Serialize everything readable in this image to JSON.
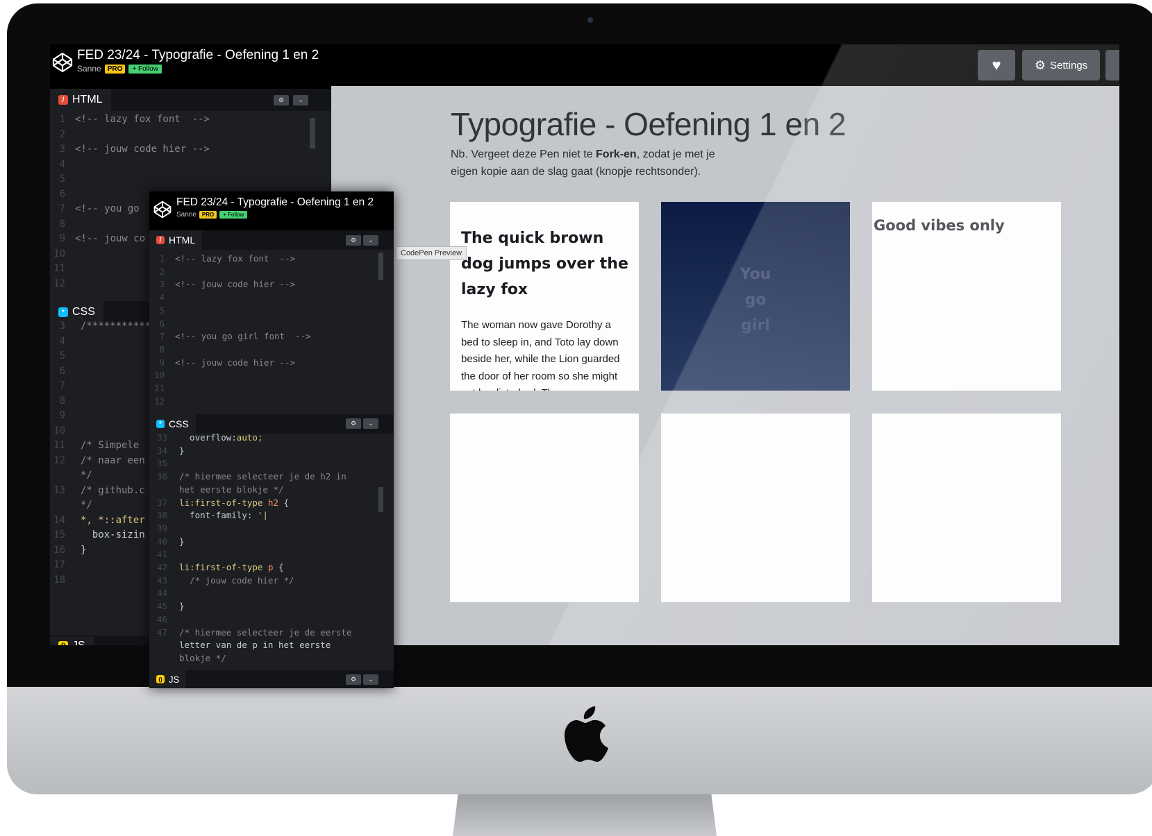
{
  "pen": {
    "title": "FED 23/24 - Typografie - Oefening 1 en 2",
    "author": "Sanne",
    "pro_badge": "PRO",
    "follow_label": "+ Follow"
  },
  "toolbar": {
    "heart_icon": "heart-icon",
    "settings_label": "Settings",
    "settings_icon": "gear-icon"
  },
  "panes": {
    "html_label": "HTML",
    "css_label": "CSS",
    "js_label": "JS"
  },
  "back_editor": {
    "html_lines": [
      {
        "n": "1",
        "text": "<!-- lazy fox font  -->"
      },
      {
        "n": "2",
        "text": ""
      },
      {
        "n": "3",
        "text": "<!-- jouw code hier -->"
      },
      {
        "n": "4",
        "text": ""
      },
      {
        "n": "5",
        "text": ""
      },
      {
        "n": "6",
        "text": ""
      },
      {
        "n": "7",
        "text": "<!-- you go"
      },
      {
        "n": "8",
        "text": ""
      },
      {
        "n": "9",
        "text": "<!-- jouw co"
      },
      {
        "n": "10",
        "text": ""
      },
      {
        "n": "11",
        "text": ""
      },
      {
        "n": "12",
        "text": ""
      }
    ],
    "css_lines": [
      {
        "n": "3",
        "text": "/***********"
      },
      {
        "n": "4",
        "text": ""
      },
      {
        "n": "5",
        "text": ""
      },
      {
        "n": "6",
        "text": ""
      },
      {
        "n": "7",
        "text": ""
      },
      {
        "n": "8",
        "text": ""
      },
      {
        "n": "9",
        "text": ""
      },
      {
        "n": "10",
        "text": ""
      },
      {
        "n": "11",
        "text": "/* Simpele"
      },
      {
        "n": "12",
        "text": "/* naar een"
      },
      {
        "n": "",
        "text": "*/"
      },
      {
        "n": "13",
        "text": "/* github.c"
      },
      {
        "n": "",
        "text": "*/"
      },
      {
        "n": "14",
        "text": "*, *::after"
      },
      {
        "n": "15",
        "text": "  box-sizin"
      },
      {
        "n": "16",
        "text": "}"
      },
      {
        "n": "17",
        "text": ""
      },
      {
        "n": "18",
        "text": ""
      }
    ]
  },
  "front_editor": {
    "html_lines": [
      {
        "n": "1",
        "text": "<!-- lazy fox font  -->"
      },
      {
        "n": "2",
        "text": ""
      },
      {
        "n": "3",
        "text": "<!-- jouw code hier -->"
      },
      {
        "n": "4",
        "text": ""
      },
      {
        "n": "5",
        "text": ""
      },
      {
        "n": "6",
        "text": ""
      },
      {
        "n": "7",
        "text": "<!-- you go girl font  -->"
      },
      {
        "n": "8",
        "text": ""
      },
      {
        "n": "9",
        "text": "<!-- jouw code hier -->"
      },
      {
        "n": "10",
        "text": ""
      },
      {
        "n": "11",
        "text": ""
      },
      {
        "n": "12",
        "text": ""
      }
    ],
    "css_lines": [
      {
        "n": "33",
        "text": "  overflow:auto;"
      },
      {
        "n": "34",
        "text": "}"
      },
      {
        "n": "35",
        "text": ""
      },
      {
        "n": "36",
        "text": "/* hiermee selecteer je de h2 in"
      },
      {
        "n": "",
        "text": "het eerste blokje */"
      },
      {
        "n": "37",
        "text": "li:first-of-type h2 {"
      },
      {
        "n": "38",
        "text": "  font-family: '|"
      },
      {
        "n": "39",
        "text": ""
      },
      {
        "n": "40",
        "text": "}"
      },
      {
        "n": "41",
        "text": ""
      },
      {
        "n": "42",
        "text": "li:first-of-type p {"
      },
      {
        "n": "43",
        "text": "  /* jouw code hier */"
      },
      {
        "n": "44",
        "text": ""
      },
      {
        "n": "45",
        "text": "}"
      },
      {
        "n": "46",
        "text": ""
      },
      {
        "n": "47",
        "text": "/* hiermee selecteer je de eerste"
      },
      {
        "n": "",
        "text": "letter van de p in het eerste"
      },
      {
        "n": "",
        "text": "blokje */"
      }
    ]
  },
  "preview": {
    "title": "Typografie - Oefening 1 en 2",
    "note_line1_pre": "Nb. Vergeet deze Pen niet te ",
    "note_line1_bold": "Fork-en",
    "note_line1_post": ", zodat je met je",
    "note_line2": "eigen kopie aan de slag gaat (knopje rechtsonder).",
    "tooltip": "CodePen Preview",
    "card1_heading": "The quick brown dog jumps over the lazy fox",
    "card1_body": "The woman now gave Dorothy a bed to sleep in, and Toto lay down beside her, while the Lion guarded the door of her room so she might not be disturbed. The",
    "card2_line1": "You",
    "card2_line2": "go",
    "card2_line3": "girl",
    "card3_heading": "Good vibes only"
  },
  "colors": {
    "html": "#e44d3a",
    "css": "#0ebeff",
    "js": "#fcd000",
    "pro": "#f5c518",
    "follow": "#47cf73"
  }
}
